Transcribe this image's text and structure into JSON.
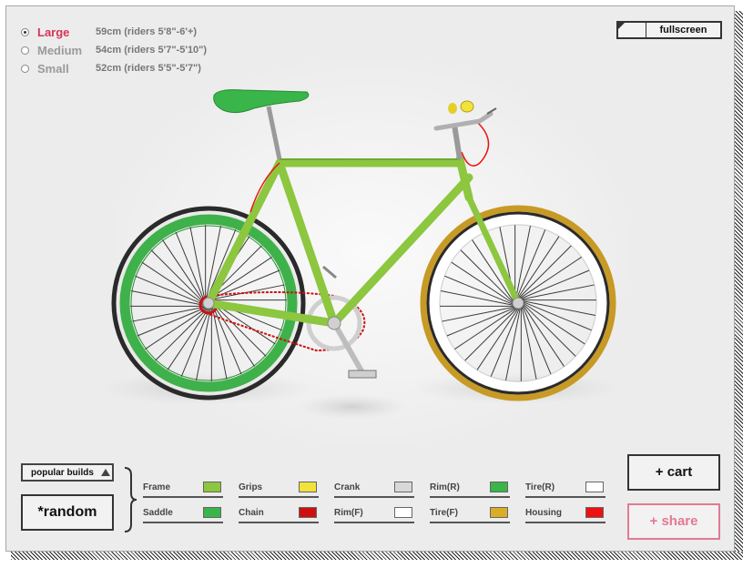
{
  "sizes": [
    {
      "name": "Large",
      "desc": "59cm (riders 5'8\"-6'+)",
      "selected": true
    },
    {
      "name": "Medium",
      "desc": "54cm (riders 5'7\"-5'10\")",
      "selected": false
    },
    {
      "name": "Small",
      "desc": "52cm (riders 5'5\"-5'7\")",
      "selected": false
    }
  ],
  "fullscreen_label": "fullscreen",
  "popular_builds_label": "popular builds",
  "random_label": "*random",
  "cart_label": "+ cart",
  "share_label": "+ share",
  "parts": [
    {
      "name": "Frame",
      "color": "#8dc63f"
    },
    {
      "name": "Grips",
      "color": "#f2e23c"
    },
    {
      "name": "Crank",
      "color": "#d8d8d8"
    },
    {
      "name": "Rim(R)",
      "color": "#39b54a"
    },
    {
      "name": "Tire(R)",
      "color": "#ffffff"
    },
    {
      "name": "Saddle",
      "color": "#39b54a"
    },
    {
      "name": "Chain",
      "color": "#cc1111"
    },
    {
      "name": "Rim(F)",
      "color": "#ffffff"
    },
    {
      "name": "Tire(F)",
      "color": "#d9ad26"
    },
    {
      "name": "Housing",
      "color": "#ee1111"
    }
  ],
  "colors": {
    "accent": "#d7335a",
    "share": "#e27a92"
  }
}
